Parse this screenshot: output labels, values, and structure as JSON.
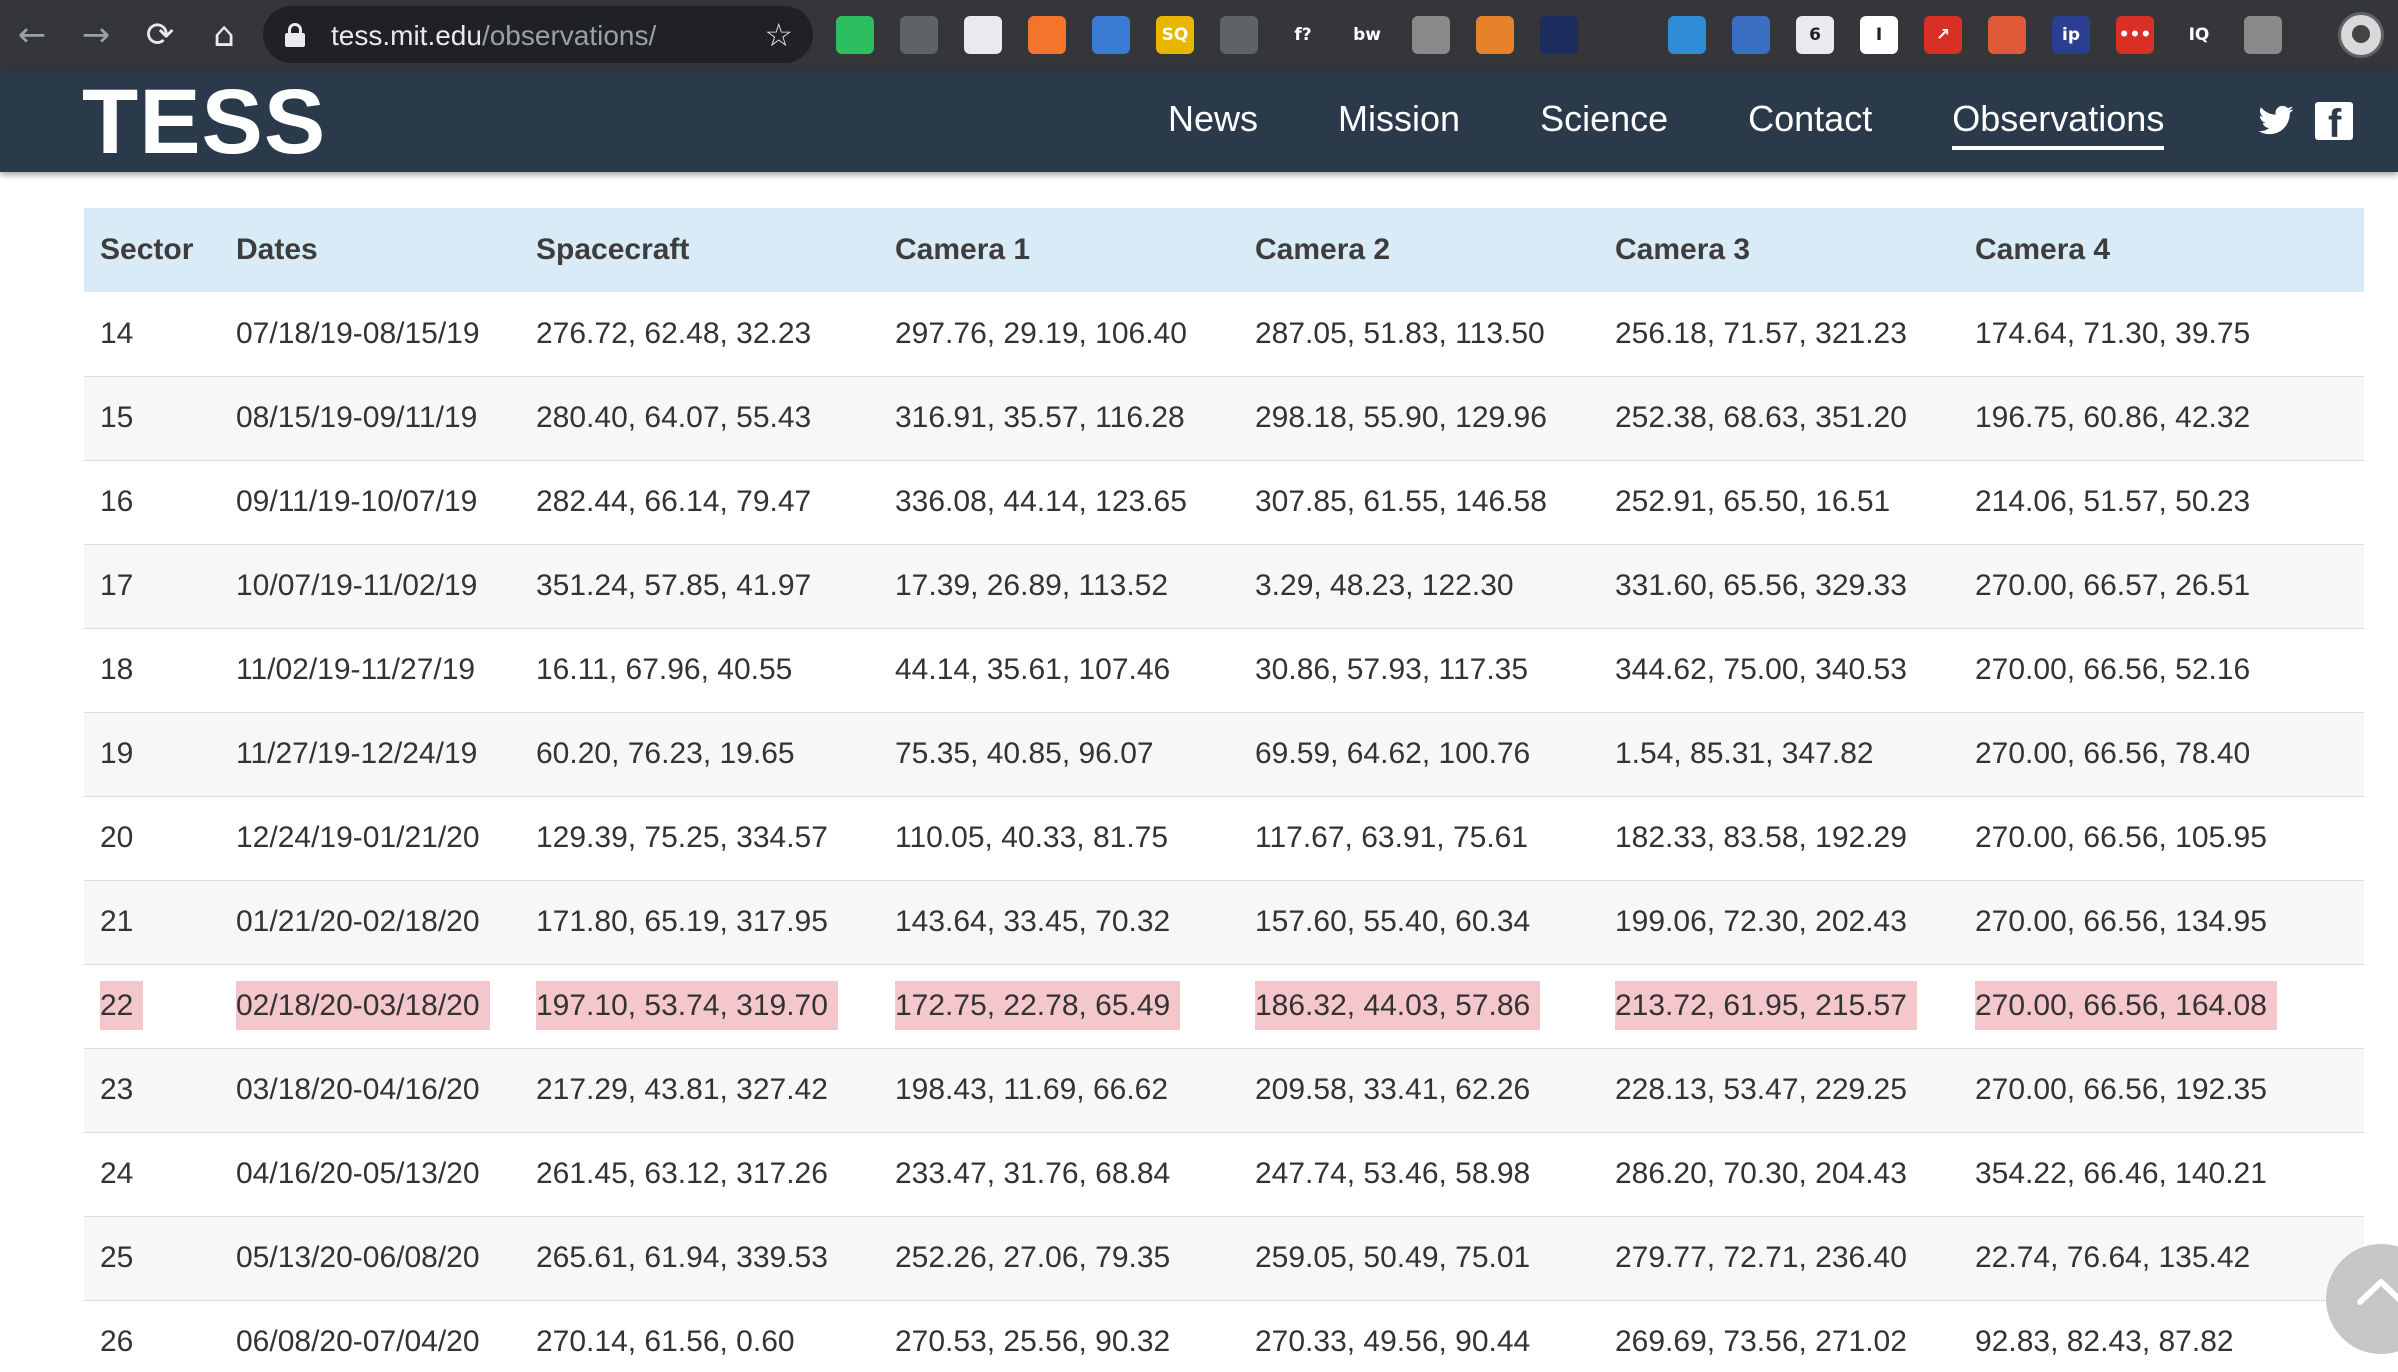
{
  "browser": {
    "url_host": "tess.mit.edu",
    "url_path": "/observations/",
    "nav": {
      "back": "←",
      "forward": "→",
      "reload": "⟳",
      "home": "⌂"
    },
    "star": "☆",
    "extensions": [
      {
        "name": "evernote-icon",
        "color": "#2dbe60",
        "glyph": ""
      },
      {
        "name": "eraser-icon",
        "color": "#5f6368",
        "glyph": ""
      },
      {
        "name": "sheets-icon",
        "color": "#e8eaed",
        "glyph": ""
      },
      {
        "name": "chart-icon",
        "color": "#f4742b",
        "glyph": ""
      },
      {
        "name": "blue-box-icon",
        "color": "#3b7bd4",
        "glyph": ""
      },
      {
        "name": "sq-icon",
        "color": "#e8b600",
        "glyph": "SQ"
      },
      {
        "name": "gear-ext-icon",
        "color": "#5f6368",
        "glyph": ""
      },
      {
        "name": "fx-icon",
        "color": "#35363a",
        "glyph": "f?"
      },
      {
        "name": "bw-icon",
        "color": "#35363a",
        "glyph": "bw"
      },
      {
        "name": "check-icon",
        "color": "#8a8a8a",
        "glyph": ""
      },
      {
        "name": "moon-icon",
        "color": "#e5822a",
        "glyph": ""
      },
      {
        "name": "space-tv-icon",
        "color": "#1c2c5c",
        "glyph": ""
      },
      {
        "name": "pen-icon",
        "color": "#35363a",
        "glyph": ""
      },
      {
        "name": "window-icon",
        "color": "#2e8bd6",
        "glyph": ""
      },
      {
        "name": "upload-icon",
        "color": "#3b6fc4",
        "glyph": ""
      },
      {
        "name": "six-icon",
        "color": "#e8eaed",
        "glyph": "6"
      },
      {
        "name": "i-icon",
        "color": "#ffffff",
        "glyph": "I"
      },
      {
        "name": "arrow-icon",
        "color": "#d93025",
        "glyph": "↗"
      },
      {
        "name": "glasses-icon",
        "color": "#e05a3a",
        "glyph": ""
      },
      {
        "name": "ip-icon",
        "color": "#2a3f8f",
        "glyph": "ip"
      },
      {
        "name": "dots-icon",
        "color": "#d93025",
        "glyph": "•••"
      },
      {
        "name": "iq-icon",
        "color": "#35363a",
        "glyph": "IQ"
      },
      {
        "name": "tag-icon",
        "color": "#8a8a8a",
        "glyph": ""
      }
    ]
  },
  "site": {
    "logo": "TESS",
    "nav": [
      {
        "label": "News",
        "current": false
      },
      {
        "label": "Mission",
        "current": false
      },
      {
        "label": "Science",
        "current": false
      },
      {
        "label": "Contact",
        "current": false
      },
      {
        "label": "Observations",
        "current": true
      }
    ]
  },
  "table": {
    "headers": [
      "Sector",
      "Dates",
      "Spacecraft",
      "Camera 1",
      "Camera 2",
      "Camera 3",
      "Camera 4"
    ],
    "rows": [
      {
        "cells": [
          "14",
          "07/18/19-08/15/19",
          "276.72, 62.48, 32.23",
          "297.76, 29.19, 106.40",
          "287.05, 51.83, 113.50",
          "256.18, 71.57, 321.23",
          "174.64, 71.30, 39.75"
        ],
        "highlight": false
      },
      {
        "cells": [
          "15",
          "08/15/19-09/11/19",
          "280.40, 64.07, 55.43",
          "316.91, 35.57, 116.28",
          "298.18, 55.90, 129.96",
          "252.38, 68.63, 351.20",
          "196.75, 60.86, 42.32"
        ],
        "highlight": false
      },
      {
        "cells": [
          "16",
          "09/11/19-10/07/19",
          "282.44, 66.14, 79.47",
          "336.08, 44.14, 123.65",
          "307.85, 61.55, 146.58",
          "252.91, 65.50, 16.51",
          "214.06, 51.57, 50.23"
        ],
        "highlight": false
      },
      {
        "cells": [
          "17",
          "10/07/19-11/02/19",
          "351.24, 57.85, 41.97",
          "17.39, 26.89, 113.52",
          "3.29, 48.23, 122.30",
          "331.60, 65.56, 329.33",
          "270.00, 66.57, 26.51"
        ],
        "highlight": false
      },
      {
        "cells": [
          "18",
          "11/02/19-11/27/19",
          "16.11, 67.96, 40.55",
          "44.14, 35.61, 107.46",
          "30.86, 57.93, 117.35",
          "344.62, 75.00, 340.53",
          "270.00, 66.56, 52.16"
        ],
        "highlight": false
      },
      {
        "cells": [
          "19",
          "11/27/19-12/24/19",
          "60.20, 76.23, 19.65",
          "75.35, 40.85, 96.07",
          "69.59, 64.62, 100.76",
          "1.54, 85.31, 347.82",
          "270.00, 66.56, 78.40"
        ],
        "highlight": false
      },
      {
        "cells": [
          "20",
          "12/24/19-01/21/20",
          "129.39, 75.25, 334.57",
          "110.05, 40.33, 81.75",
          "117.67, 63.91, 75.61",
          "182.33, 83.58, 192.29",
          "270.00, 66.56, 105.95"
        ],
        "highlight": false
      },
      {
        "cells": [
          "21",
          "01/21/20-02/18/20",
          "171.80, 65.19, 317.95",
          "143.64, 33.45, 70.32",
          "157.60, 55.40, 60.34",
          "199.06, 72.30, 202.43",
          "270.00, 66.56, 134.95"
        ],
        "highlight": false
      },
      {
        "cells": [
          "22",
          "02/18/20-03/18/20",
          "197.10, 53.74, 319.70",
          "172.75, 22.78, 65.49",
          "186.32, 44.03, 57.86",
          "213.72, 61.95, 215.57",
          "270.00, 66.56, 164.08"
        ],
        "highlight": true
      },
      {
        "cells": [
          "23",
          "03/18/20-04/16/20",
          "217.29, 43.81, 327.42",
          "198.43, 11.69, 66.62",
          "209.58, 33.41, 62.26",
          "228.13, 53.47, 229.25",
          "270.00, 66.56, 192.35"
        ],
        "highlight": false
      },
      {
        "cells": [
          "24",
          "04/16/20-05/13/20",
          "261.45, 63.12, 317.26",
          "233.47, 31.76, 68.84",
          "247.74, 53.46, 58.98",
          "286.20, 70.30, 204.43",
          "354.22, 66.46, 140.21"
        ],
        "highlight": false
      },
      {
        "cells": [
          "25",
          "05/13/20-06/08/20",
          "265.61, 61.94, 339.53",
          "252.26, 27.06, 79.35",
          "259.05, 50.49, 75.01",
          "279.77, 72.71, 236.40",
          "22.74, 76.64, 135.42"
        ],
        "highlight": false
      },
      {
        "cells": [
          "26",
          "06/08/20-07/04/20",
          "270.14, 61.56, 0.60",
          "270.53, 25.56, 90.32",
          "270.33, 49.56, 90.44",
          "269.69, 73.56, 271.02",
          "92.83, 82.43, 87.82"
        ],
        "highlight": false
      }
    ]
  },
  "colors": {
    "header_bg": "#2b3a4a",
    "table_header_bg": "#d9ebf7",
    "highlight": "#f4c7cd",
    "chrome_bg": "#35363a"
  }
}
